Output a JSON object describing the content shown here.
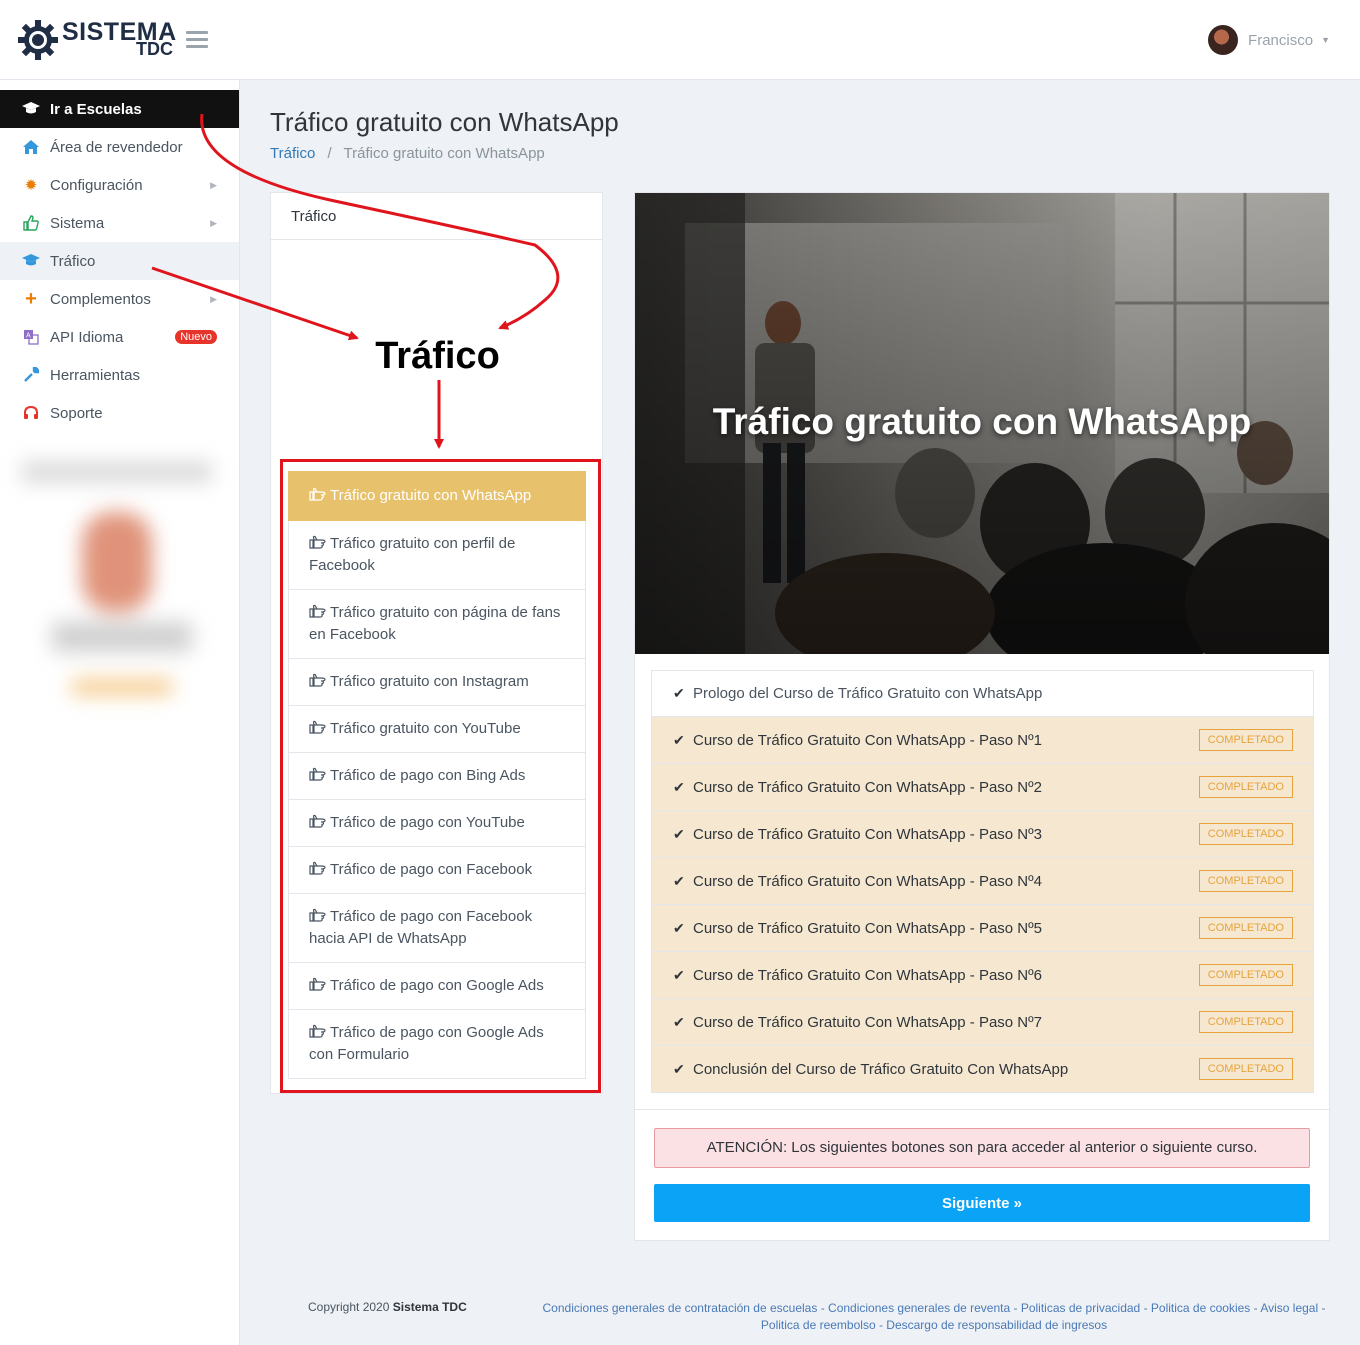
{
  "header": {
    "logo_main": "SISTEMA",
    "logo_sub": "TDC",
    "user_name": "Francisco"
  },
  "sidebar": {
    "items": [
      {
        "label": "Ir a Escuelas",
        "icon": "graduation-cap-icon"
      },
      {
        "label": "Área de revendedor",
        "icon": "home-icon"
      },
      {
        "label": "Configuración",
        "icon": "gear-icon"
      },
      {
        "label": "Sistema",
        "icon": "thumbs-up-icon"
      },
      {
        "label": "Tráfico",
        "icon": "graduation-cap-icon"
      },
      {
        "label": "Complementos",
        "icon": "plus-icon"
      },
      {
        "label": "API Idioma",
        "icon": "translate-icon",
        "badge": "Nuevo"
      },
      {
        "label": "Herramientas",
        "icon": "wrench-icon"
      },
      {
        "label": "Soporte",
        "icon": "headphones-icon"
      }
    ]
  },
  "page": {
    "title": "Tráfico gratuito con WhatsApp",
    "breadcrumb": {
      "link": "Tráfico",
      "sep": "/",
      "current": "Tráfico gratuito con WhatsApp"
    }
  },
  "left_panel": {
    "header": "Tráfico",
    "annotation_label": "Tráfico",
    "courses": [
      "Tráfico gratuito con WhatsApp",
      "Tráfico gratuito con perfil de Facebook",
      "Tráfico gratuito con página de fans en Facebook",
      "Tráfico gratuito con Instagram",
      "Tráfico gratuito con YouTube",
      "Tráfico de pago con Bing Ads",
      "Tráfico de pago con YouTube",
      "Tráfico de pago con Facebook",
      "Tráfico de pago con Facebook hacia API de WhatsApp",
      "Tráfico de pago con Google Ads",
      "Tráfico de pago con Google Ads con Formulario"
    ]
  },
  "right_panel": {
    "hero_title": "Tráfico gratuito con WhatsApp",
    "steps": [
      {
        "label": "Prologo del Curso de Tráfico Gratuito con WhatsApp",
        "status": ""
      },
      {
        "label": "Curso de Tráfico Gratuito Con WhatsApp - Paso Nº1",
        "status": "COMPLETADO"
      },
      {
        "label": "Curso de Tráfico Gratuito Con WhatsApp - Paso Nº2",
        "status": "COMPLETADO"
      },
      {
        "label": "Curso de Tráfico Gratuito Con WhatsApp - Paso Nº3",
        "status": "COMPLETADO"
      },
      {
        "label": "Curso de Tráfico Gratuito Con WhatsApp - Paso Nº4",
        "status": "COMPLETADO"
      },
      {
        "label": "Curso de Tráfico Gratuito Con WhatsApp - Paso Nº5",
        "status": "COMPLETADO"
      },
      {
        "label": "Curso de Tráfico Gratuito Con WhatsApp - Paso Nº6",
        "status": "COMPLETADO"
      },
      {
        "label": "Curso de Tráfico Gratuito Con WhatsApp - Paso Nº7",
        "status": "COMPLETADO"
      },
      {
        "label": "Conclusión del Curso de Tráfico Gratuito Con WhatsApp",
        "status": "COMPLETADO"
      }
    ],
    "alert": "ATENCIÓN: Los siguientes botones son para acceder al anterior o siguiente curso.",
    "next_button": "Siguiente »"
  },
  "footer": {
    "copyright_prefix": "Copyright 2020",
    "copyright_brand": "Sistema TDC",
    "links": [
      "Condiciones generales de contratación de escuelas",
      "Condiciones generales de reventa",
      "Politicas de privacidad",
      "Politica de cookies",
      "Aviso legal",
      "Politica de reembolso",
      "Descargo de responsabilidad de ingresos"
    ],
    "link_separator": " - "
  },
  "colors": {
    "active_course": "#e8c16c",
    "completed_badge": "#e8a33c",
    "next_button": "#0aa3f5",
    "annotation_red": "#e0141c"
  }
}
